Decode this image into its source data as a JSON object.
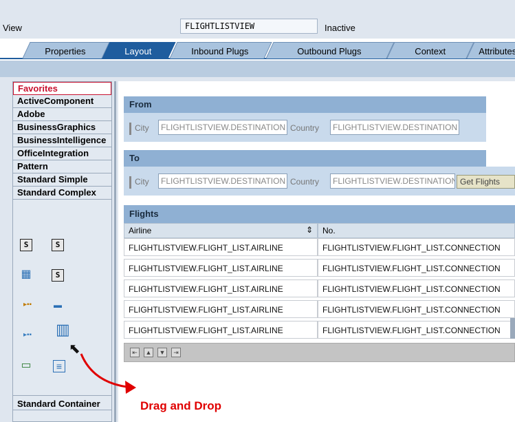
{
  "view": {
    "label": "View",
    "name": "FLIGHTLISTVIEW",
    "status": "Inactive"
  },
  "tabs": [
    {
      "label": "Properties"
    },
    {
      "label": "Layout"
    },
    {
      "label": "Inbound Plugs"
    },
    {
      "label": "Outbound Plugs"
    },
    {
      "label": "Context"
    },
    {
      "label": "Attributes"
    }
  ],
  "palette": {
    "items": [
      {
        "label": "Favorites"
      },
      {
        "label": "ActiveComponent"
      },
      {
        "label": "Adobe"
      },
      {
        "label": "BusinessGraphics"
      },
      {
        "label": "BusinessIntelligence"
      },
      {
        "label": "OfficeIntegration"
      },
      {
        "label": "Pattern"
      },
      {
        "label": "Standard Simple"
      },
      {
        "label": "Standard Complex"
      }
    ],
    "bottom": "Standard Container"
  },
  "from_group": {
    "title": "From",
    "city_label": "City",
    "city_value": "FLIGHTLISTVIEW.DESTINATION",
    "country_label": "Country",
    "country_value": "FLIGHTLISTVIEW.DESTINATION"
  },
  "to_group": {
    "title": "To",
    "city_label": "City",
    "city_value": "FLIGHTLISTVIEW.DESTINATION",
    "country_label": "Country",
    "country_value": "FLIGHTLISTVIEW.DESTINATION",
    "button": "Get Flights"
  },
  "flights": {
    "title": "Flights",
    "columns": [
      "Airline",
      "No."
    ],
    "rows": [
      [
        "FLIGHTLISTVIEW.FLIGHT_LIST.AIRLINE",
        "FLIGHTLISTVIEW.FLIGHT_LIST.CONNECTION"
      ],
      [
        "FLIGHTLISTVIEW.FLIGHT_LIST.AIRLINE",
        "FLIGHTLISTVIEW.FLIGHT_LIST.CONNECTION"
      ],
      [
        "FLIGHTLISTVIEW.FLIGHT_LIST.AIRLINE",
        "FLIGHTLISTVIEW.FLIGHT_LIST.CONNECTION"
      ],
      [
        "FLIGHTLISTVIEW.FLIGHT_LIST.AIRLINE",
        "FLIGHTLISTVIEW.FLIGHT_LIST.CONNECTION"
      ],
      [
        "FLIGHTLISTVIEW.FLIGHT_LIST.AIRLINE",
        "FLIGHTLISTVIEW.FLIGHT_LIST.CONNECTION"
      ]
    ]
  },
  "annotation": {
    "text": "Drag and Drop",
    "color": "#e00000"
  },
  "icons": {
    "s_box": "S",
    "grid": "▦",
    "dots": "▸▪▪",
    "bar": "▬",
    "table": "▥",
    "folder": "▭",
    "tree": "≡",
    "sort": "⇕",
    "cursor": "⬉",
    "nav_first": "⇤",
    "nav_prev": "▲",
    "nav_next": "▼",
    "nav_last": "⇥"
  },
  "colors": {
    "accent": "#1f5d9e",
    "favorites": "#c8102e"
  }
}
